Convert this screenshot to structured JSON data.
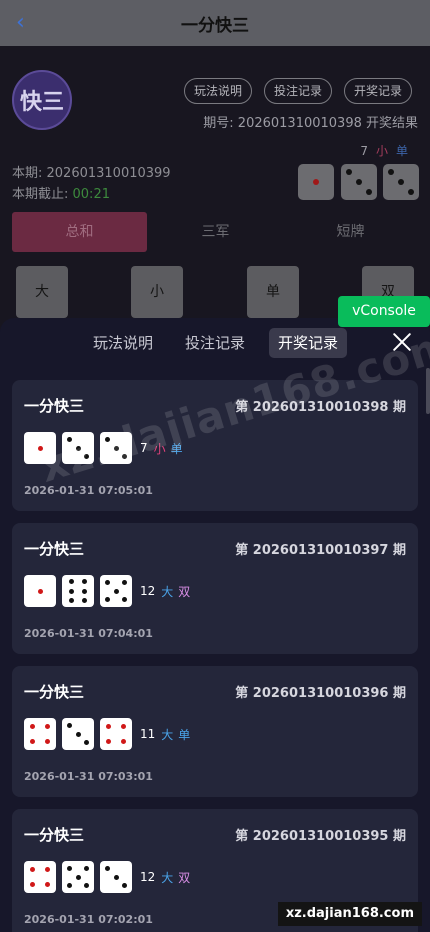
{
  "nav": {
    "back_icon": "chevron-left-icon",
    "title": "一分快三"
  },
  "game": {
    "logo_text": "快三",
    "top_buttons": [
      "玩法说明",
      "投注记录",
      "开奖记录"
    ],
    "period_result": "期号: 202601310010398 开奖结果",
    "last_sum": "7",
    "last_size": "小",
    "last_odd": "单",
    "current_issue": "本期: 202601310010399",
    "deadline_label": "本期截止: ",
    "countdown": "00:21",
    "tabs": [
      "总和",
      "三军",
      "短牌"
    ],
    "active_tab": 0,
    "bet_options": [
      "大",
      "小",
      "单",
      "双"
    ],
    "vconsole": "vConsole",
    "last_dice": [
      1,
      3,
      3
    ]
  },
  "sheet": {
    "tabs": [
      "玩法说明",
      "投注记录",
      "开奖记录"
    ],
    "active_tab": 2,
    "close_icon": "close-icon",
    "records": [
      {
        "name": "一分快三",
        "issue": "第 202601310010398 期",
        "dice": [
          1,
          3,
          3
        ],
        "sum": "7",
        "size": "小",
        "odd": "单",
        "time": "2026-01-31 07:05:01"
      },
      {
        "name": "一分快三",
        "issue": "第 202601310010397 期",
        "dice": [
          1,
          6,
          5
        ],
        "sum": "12",
        "size": "大",
        "odd": "双",
        "time": "2026-01-31 07:04:01"
      },
      {
        "name": "一分快三",
        "issue": "第 202601310010396 期",
        "dice": [
          4,
          3,
          4
        ],
        "sum": "11",
        "size": "大",
        "odd": "单",
        "time": "2026-01-31 07:03:01"
      },
      {
        "name": "一分快三",
        "issue": "第 202601310010395 期",
        "dice": [
          4,
          5,
          3
        ],
        "sum": "12",
        "size": "大",
        "odd": "双",
        "time": "2026-01-31 07:02:01"
      }
    ]
  },
  "colors": {
    "big": "#4aa3e8",
    "small": "#e0407a",
    "odd": "#4aa3e8",
    "even": "#d98ee6",
    "accent": "#09bc5b"
  },
  "watermark": {
    "diagonal": "xz.dajian168.com",
    "badge": "xz.dajian168.com"
  }
}
